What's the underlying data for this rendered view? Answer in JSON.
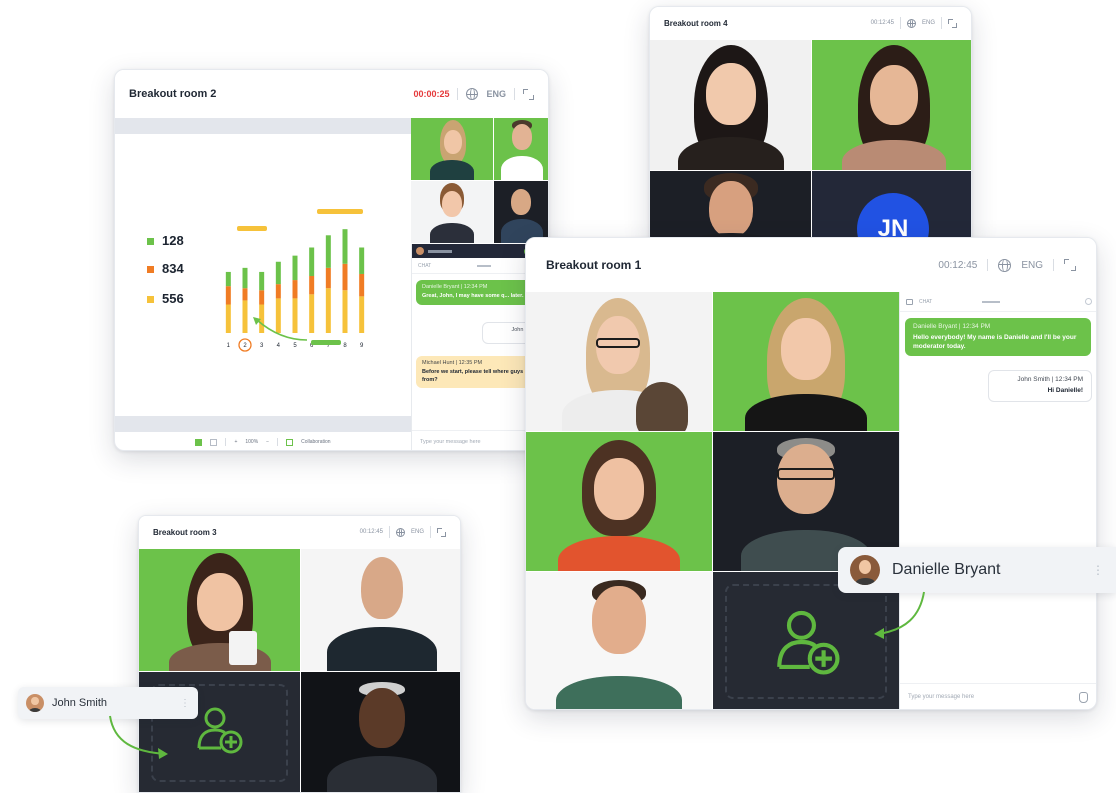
{
  "colors": {
    "accent_green": "#6cc24a",
    "timer_red": "#e5393b",
    "bar_orange": "#f07c24",
    "bar_yellow": "#f6c23a",
    "jn_blue": "#2152e3"
  },
  "room2": {
    "title": "Breakout room 2",
    "timer": "00:00:25",
    "language": "ENG",
    "stats": [
      {
        "value": "128",
        "color": "#6cc24a"
      },
      {
        "value": "834",
        "color": "#f07c24"
      },
      {
        "value": "556",
        "color": "#f6c23a"
      }
    ],
    "chart_data": {
      "type": "bar",
      "categories": [
        "1",
        "2",
        "3",
        "4",
        "5",
        "6",
        "7",
        "8",
        "9"
      ],
      "series": [
        {
          "color": "#f6c23a",
          "values": [
            14,
            16,
            14,
            17,
            17,
            19,
            22,
            21,
            18
          ]
        },
        {
          "color": "#f07c24",
          "values": [
            9,
            6,
            7,
            7,
            9,
            9,
            10,
            13,
            11
          ]
        },
        {
          "color": "#6cc24a",
          "values": [
            7,
            10,
            9,
            11,
            12,
            14,
            16,
            17,
            13
          ]
        }
      ],
      "ylim": [
        0,
        56
      ]
    },
    "zoom": "100%",
    "collaboration": "Collaboration",
    "chat": {
      "tab": "CHAT",
      "messages": [
        {
          "meta": "Danielle Bryant  |  12:34 PM",
          "text": "Great, John, I may have some q... later."
        },
        {
          "meta": "John Smith",
          "text": ""
        },
        {
          "meta": "Michael Hunt  |  12:35 PM",
          "text": "Before we start, please tell where guys from?"
        }
      ],
      "placeholder": "Type your message here"
    }
  },
  "room4": {
    "title": "Breakout room 4",
    "timer": "00:12:45",
    "language": "ENG",
    "avatar_initials": "JN"
  },
  "room1": {
    "title": "Breakout room 1",
    "timer": "00:12:45",
    "language": "ENG",
    "chat": {
      "tab": "CHAT",
      "messages": [
        {
          "meta": "Danielle Bryant  |  12:34 PM",
          "text": "Hello everybody! My name is Danielle and I'll be your moderator today."
        },
        {
          "meta": "John Smith  |  12:34 PM",
          "text": "Hi Danielle!"
        }
      ],
      "placeholder": "Type your message here"
    },
    "name_tag": "Danielle Bryant"
  },
  "room3": {
    "title": "Breakout room 3",
    "timer": "00:12:45",
    "language": "ENG",
    "name_tag": "John Smith"
  }
}
